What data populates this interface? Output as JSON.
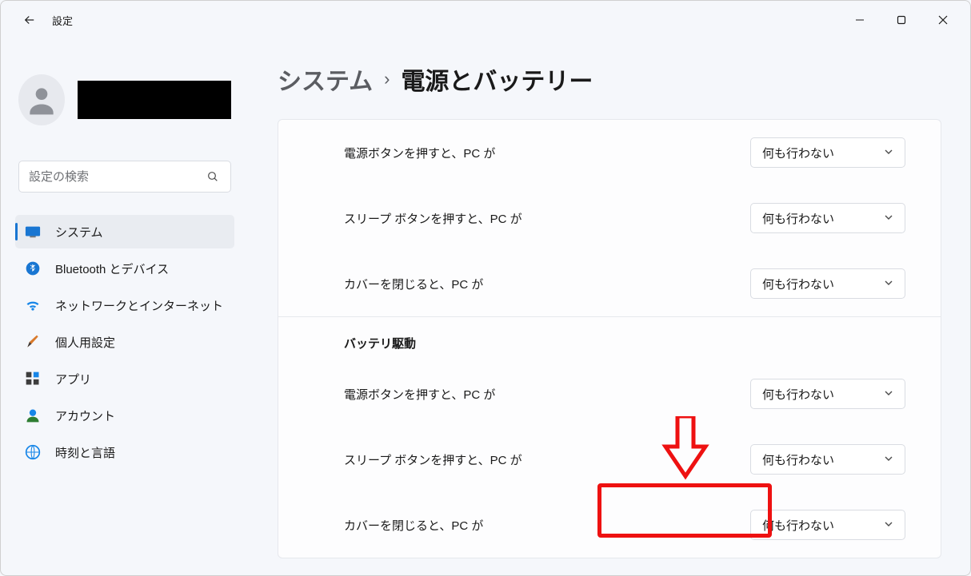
{
  "app": {
    "title": "設定"
  },
  "search": {
    "placeholder": "設定の検索"
  },
  "sidebar": {
    "items": [
      {
        "label": "システム"
      },
      {
        "label": "Bluetooth とデバイス"
      },
      {
        "label": "ネットワークとインターネット"
      },
      {
        "label": "個人用設定"
      },
      {
        "label": "アプリ"
      },
      {
        "label": "アカウント"
      },
      {
        "label": "時刻と言語"
      }
    ]
  },
  "breadcrumb": {
    "parent": "システム",
    "sep": "›",
    "current": "電源とバッテリー"
  },
  "panel": {
    "section1": {
      "rows": [
        {
          "label": "電源ボタンを押すと、PC が",
          "value": "何も行わない"
        },
        {
          "label": "スリープ ボタンを押すと、PC が",
          "value": "何も行わない"
        },
        {
          "label": "カバーを閉じると、PC が",
          "value": "何も行わない"
        }
      ]
    },
    "section2": {
      "header": "バッテリ駆動",
      "rows": [
        {
          "label": "電源ボタンを押すと、PC が",
          "value": "何も行わない"
        },
        {
          "label": "スリープ ボタンを押すと、PC が",
          "value": "何も行わない"
        },
        {
          "label": "カバーを閉じると、PC が",
          "value": "何も行わない"
        }
      ]
    }
  }
}
